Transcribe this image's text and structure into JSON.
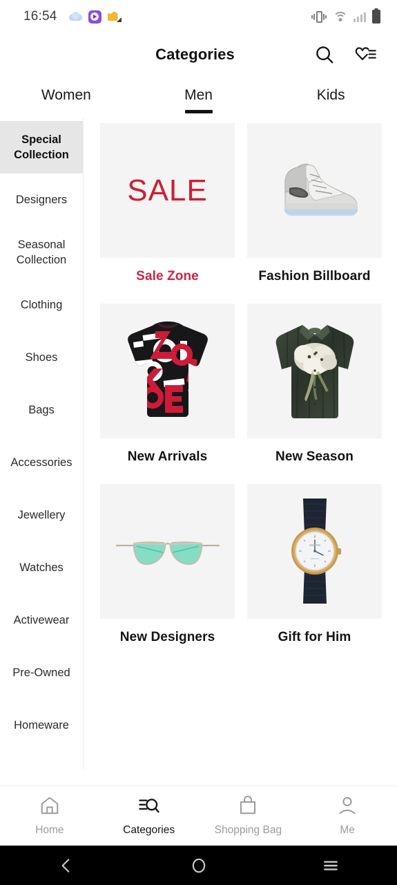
{
  "status_bar": {
    "time": "16:54",
    "left_icons": [
      "cloud-icon",
      "purple-app-icon",
      "gold-folder-icon"
    ],
    "right_icons": [
      "vibrate-icon",
      "wifi-icon",
      "signal-icon",
      "battery-icon"
    ]
  },
  "header": {
    "title": "Categories",
    "actions": [
      {
        "name": "search-icon"
      },
      {
        "name": "wishlist-heart-icon"
      }
    ]
  },
  "tabs": [
    {
      "label": "Women",
      "active": false
    },
    {
      "label": "Men",
      "active": true
    },
    {
      "label": "Kids",
      "active": false
    }
  ],
  "sidebar": {
    "items": [
      {
        "label": "Special Collection",
        "active": true
      },
      {
        "label": "Designers",
        "active": false
      },
      {
        "label": "Seasonal Collection",
        "active": false
      },
      {
        "label": "Clothing",
        "active": false
      },
      {
        "label": "Shoes",
        "active": false
      },
      {
        "label": "Bags",
        "active": false
      },
      {
        "label": "Accessories",
        "active": false
      },
      {
        "label": "Jewellery",
        "active": false
      },
      {
        "label": "Watches",
        "active": false
      },
      {
        "label": "Activewear",
        "active": false
      },
      {
        "label": "Pre-Owned",
        "active": false
      },
      {
        "label": "Homeware",
        "active": false
      }
    ]
  },
  "grid": {
    "cards": [
      {
        "label": "Sale Zone",
        "image": "sale-text-tile",
        "badge_text": "SALE",
        "label_color": "#cc2644"
      },
      {
        "label": "Fashion Billboard",
        "image": "grey-high-top-sneaker",
        "label_color": "#131313"
      },
      {
        "label": "New Arrivals",
        "image": "black-red-logo-sweater",
        "label_color": "#131313"
      },
      {
        "label": "New Season",
        "image": "green-floral-shirt",
        "label_color": "#131313"
      },
      {
        "label": "New Designers",
        "image": "mint-aviator-sunglasses",
        "label_color": "#131313"
      },
      {
        "label": "Gift for Him",
        "image": "gold-dress-watch",
        "label_color": "#131313"
      }
    ]
  },
  "bottom_nav": [
    {
      "label": "Home",
      "icon": "home-icon",
      "active": false
    },
    {
      "label": "Categories",
      "icon": "categories-search-icon",
      "active": true
    },
    {
      "label": "Shopping Bag",
      "icon": "shopping-bag-icon",
      "active": false
    },
    {
      "label": "Me",
      "icon": "person-icon",
      "active": false
    }
  ],
  "android_nav": [
    {
      "name": "back-icon"
    },
    {
      "name": "home-circle-icon"
    },
    {
      "name": "recents-menu-icon"
    }
  ],
  "colors": {
    "sale_red": "#cc2033",
    "accent_dark": "#121212",
    "tile_bg": "#f4f4f4",
    "active_sidebar_bg": "#e6e6e6",
    "inactive_nav": "#9b9b9b"
  }
}
